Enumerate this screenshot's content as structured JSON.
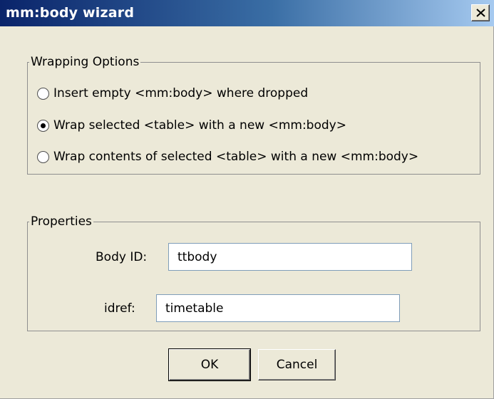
{
  "window": {
    "title": "mm:body wizard"
  },
  "wrapping": {
    "group_label": "Wrapping Options",
    "options": [
      {
        "label": "Insert empty <mm:body> where dropped",
        "checked": false
      },
      {
        "label": "Wrap selected <table> with a new <mm:body>",
        "checked": true
      },
      {
        "label": "Wrap contents of selected <table> with a new <mm:body>",
        "checked": false
      }
    ]
  },
  "properties": {
    "group_label": "Properties",
    "body_id_label": "Body ID:",
    "body_id_value": "ttbody",
    "idref_label": "idref:",
    "idref_value": "timetable"
  },
  "buttons": {
    "ok_label": "OK",
    "cancel_label": "Cancel"
  }
}
